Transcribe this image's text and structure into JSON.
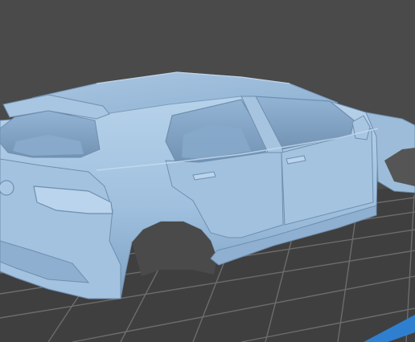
{
  "viewport": {
    "background": "#4a4a4a",
    "floor_color": "#3d3d3d",
    "grid_line_color": "#6e6e6e",
    "model_color": "#9fc0de",
    "model_shadow_color": "#6f8fb0",
    "model_highlight_color": "#c8ddf0",
    "accent_edge_color": "#2f7fd1"
  },
  "model": {
    "icon": "car-body-3d-model"
  }
}
